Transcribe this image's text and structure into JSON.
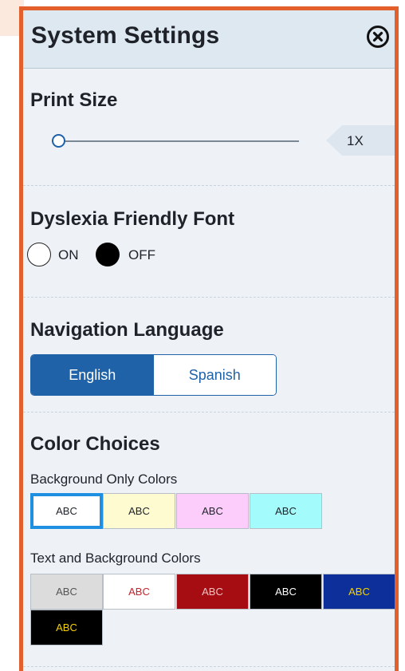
{
  "header": {
    "title": "System Settings",
    "close_icon": "close-circle-icon"
  },
  "print_size": {
    "title": "Print Size",
    "slider_value": 0,
    "zoom_label": "1X"
  },
  "dyslexia": {
    "title": "Dyslexia Friendly Font",
    "options": [
      {
        "label": "ON",
        "selected": false
      },
      {
        "label": "OFF",
        "selected": true
      }
    ]
  },
  "navigation_language": {
    "title": "Navigation Language",
    "options": [
      {
        "label": "English",
        "selected": true
      },
      {
        "label": "Spanish",
        "selected": false
      }
    ]
  },
  "color_choices": {
    "title": "Color Choices",
    "background_only": {
      "label": "Background Only Colors",
      "swatches": [
        {
          "text": "ABC",
          "bg": "#ffffff",
          "fg": "#1f2229",
          "selected": true
        },
        {
          "text": "ABC",
          "bg": "#fdfbcf",
          "fg": "#1f2229",
          "selected": false
        },
        {
          "text": "ABC",
          "bg": "#fccdfb",
          "fg": "#1f2229",
          "selected": false
        },
        {
          "text": "ABC",
          "bg": "#a3fbfb",
          "fg": "#1f2229",
          "selected": false
        }
      ]
    },
    "text_and_background": {
      "label": "Text and Background Colors",
      "swatches": [
        {
          "text": "ABC",
          "bg": "#dcdcdc",
          "fg": "#555555"
        },
        {
          "text": "ABC",
          "bg": "#ffffff",
          "fg": "#c0242e"
        },
        {
          "text": "ABC",
          "bg": "#a50d12",
          "fg": "#f1c2c2"
        },
        {
          "text": "ABC",
          "bg": "#000000",
          "fg": "#ffffff"
        },
        {
          "text": "ABC",
          "bg": "#0d2f9a",
          "fg": "#f4d000"
        },
        {
          "text": "ABC",
          "bg": "#000000",
          "fg": "#f4d000"
        }
      ]
    }
  },
  "colors": {
    "accent": "#1f62a7",
    "border": "#e3602c",
    "panel_bg": "#eef2f7",
    "header_bg": "#dde8f1"
  }
}
